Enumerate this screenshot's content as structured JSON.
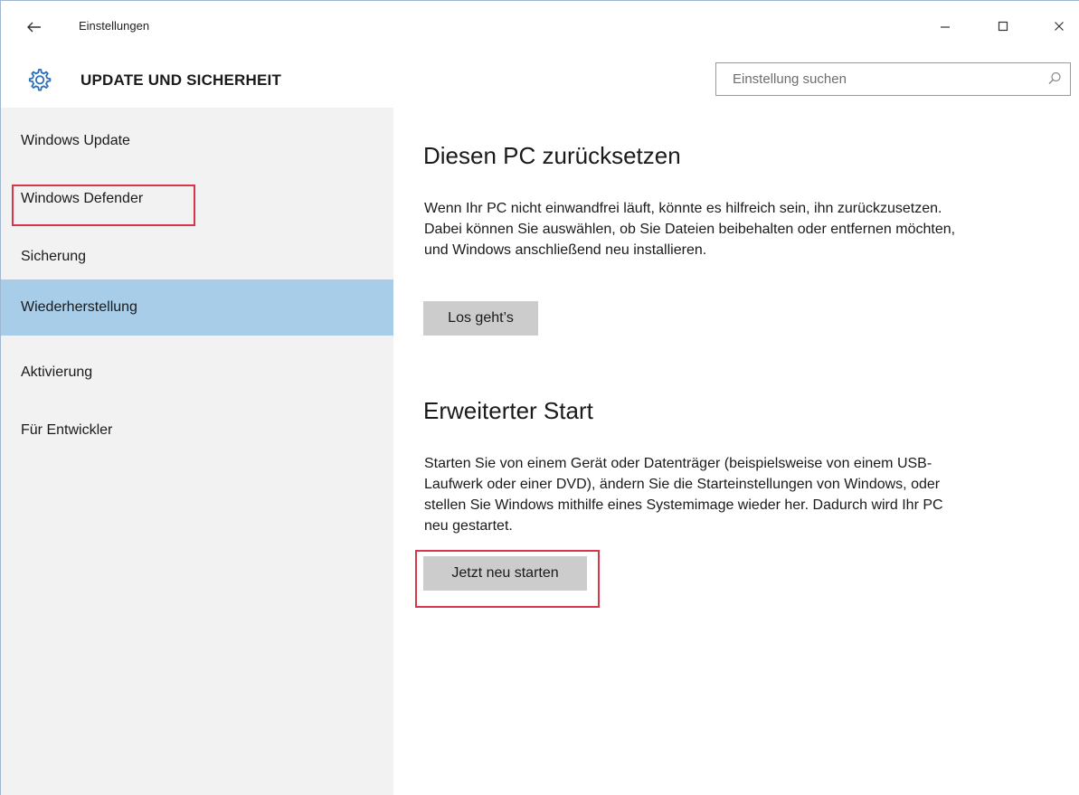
{
  "window": {
    "app_title": "Einstellungen",
    "back_icon": "arrow-left-icon",
    "minimize_icon": "minimize-icon",
    "maximize_icon": "maximize-icon",
    "close_icon": "close-icon"
  },
  "header": {
    "icon": "gear-icon",
    "title": "UPDATE UND SICHERHEIT",
    "search_placeholder": "Einstellung suchen",
    "search_icon": "search-icon"
  },
  "sidebar": {
    "items": [
      {
        "label": "Windows Update",
        "selected": false
      },
      {
        "label": "Windows Defender",
        "selected": false
      },
      {
        "label": "Sicherung",
        "selected": false
      },
      {
        "label": "Wiederherstellung",
        "selected": true
      },
      {
        "label": "Aktivierung",
        "selected": false
      },
      {
        "label": "Für Entwickler",
        "selected": false
      }
    ]
  },
  "main": {
    "sections": [
      {
        "heading": "Diesen PC zurücksetzen",
        "body": "Wenn Ihr PC nicht einwandfrei läuft, könnte es hilfreich sein, ihn zurückzusetzen. Dabei können Sie auswählen, ob Sie Dateien beibehalten oder entfernen möchten, und Windows anschließend neu installieren.",
        "button": "Los geht’s"
      },
      {
        "heading": "Erweiterter Start",
        "body": "Starten Sie von einem Gerät oder Datenträger (beispielsweise von einem USB-Laufwerk oder einer DVD), ändern Sie die Starteinstellungen von Windows, oder stellen Sie Windows mithilfe eines Systemimage wieder her. Dadurch wird Ihr PC neu gestartet.",
        "button": "Jetzt neu starten"
      }
    ]
  },
  "colors": {
    "accent": "#a7cde9",
    "highlight": "#d9364a",
    "sidebar_bg": "#f2f2f2",
    "button_bg": "#cccccc"
  }
}
